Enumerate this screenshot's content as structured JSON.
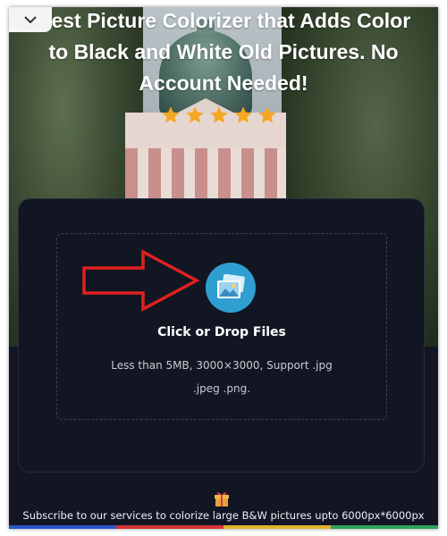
{
  "header": {
    "title_lines": [
      "Best Picture Colorizer that Adds Color",
      "to Black and White Old Pictures. No",
      "Account Needed!"
    ],
    "rating_stars": 5,
    "dropdown_icon": "chevron-down-icon"
  },
  "upload": {
    "icon": "image-upload-icon",
    "title": "Click or Drop Files",
    "hint_line1": "Less than 5MB, 3000×3000, Support .jpg",
    "hint_line2": ".jpeg .png."
  },
  "annotation": {
    "arrow_color": "#e02020"
  },
  "footer": {
    "gift_icon": "gift-icon",
    "subscribe_text": "Subscribe to our services to colorize large B&W pictures upto 6000px*6000px"
  },
  "colors": {
    "page_bg": "#121624",
    "card_bg": "#111622",
    "accent": "#2f9fd1",
    "star": "#f5a623"
  }
}
